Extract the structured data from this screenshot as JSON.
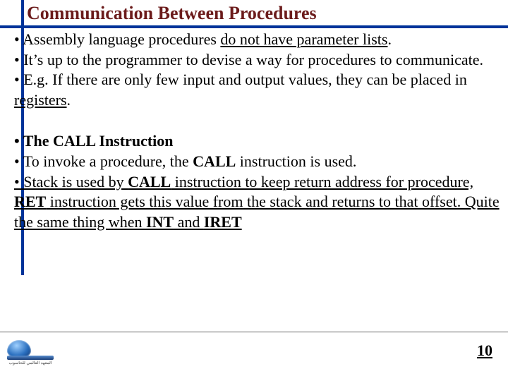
{
  "title": "Communication Between Procedures",
  "b1_pre": "• Assembly language procedures ",
  "b1_ul": "do not have parameter lists",
  "b1_post": ".",
  "b2": "• It’s up to the programmer to devise a way for procedures to communicate.",
  "b3_pre": "• E.g. If there are only few input and output values, they can be placed in ",
  "b3_ul": "registers",
  "b3_post": ".",
  "b4": "• The CALL Instruction",
  "b5_a": "• To invoke a procedure, the ",
  "b5_b": "CALL",
  "b5_c": " instruction is used.",
  "b6_a": "• Stack is used by ",
  "b6_b": "CALL",
  "b6_c": " instruction to keep return address for procedure, ",
  "b6_d": "RET",
  "b6_e": " instruction gets this value from the stack and returns to that offset. Quite the same thing when ",
  "b6_f": "INT",
  "b6_g": " and ",
  "b6_h": "IRET",
  "footer_small": "المعهد العالمي للحاسوب",
  "page": "10"
}
